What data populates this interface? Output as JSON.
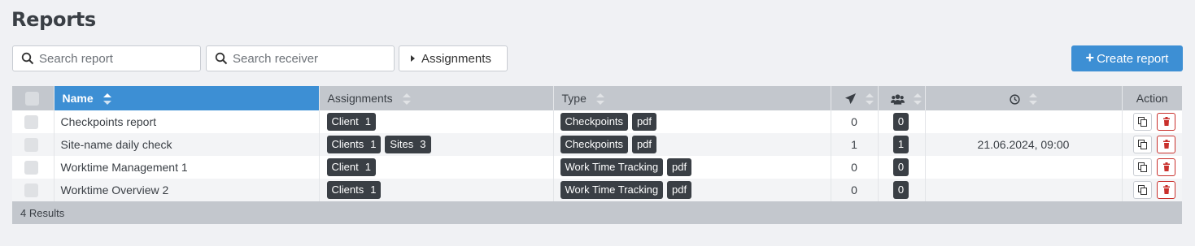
{
  "page": {
    "title": "Reports"
  },
  "toolbar": {
    "search_report_placeholder": "Search report",
    "search_receiver_placeholder": "Search receiver",
    "assignments_label": "Assignments",
    "create_label": "Create report"
  },
  "table": {
    "headers": {
      "name": "Name",
      "assignments": "Assignments",
      "type": "Type",
      "action": "Action"
    },
    "header_icons": {
      "sent": "paper-plane-icon",
      "receivers": "users-icon",
      "schedule": "clock-icon"
    },
    "rows": [
      {
        "name": "Checkpoints report",
        "assignments": [
          {
            "label": "Client",
            "count": "1"
          }
        ],
        "type": [
          "Checkpoints",
          "pdf"
        ],
        "sent": "0",
        "receivers": "0",
        "schedule": ""
      },
      {
        "name": "Site-name daily check",
        "assignments": [
          {
            "label": "Clients",
            "count": "1"
          },
          {
            "label": "Sites",
            "count": "3"
          }
        ],
        "type": [
          "Checkpoints",
          "pdf"
        ],
        "sent": "1",
        "receivers": "1",
        "schedule": "21.06.2024, 09:00"
      },
      {
        "name": "Worktime Management 1",
        "assignments": [
          {
            "label": "Client",
            "count": "1"
          }
        ],
        "type": [
          "Work Time Tracking",
          "pdf"
        ],
        "sent": "0",
        "receivers": "0",
        "schedule": ""
      },
      {
        "name": "Worktime Overview 2",
        "assignments": [
          {
            "label": "Clients",
            "count": "1"
          }
        ],
        "type": [
          "Work Time Tracking",
          "pdf"
        ],
        "sent": "0",
        "receivers": "0",
        "schedule": ""
      }
    ],
    "footer": "4 Results"
  },
  "colors": {
    "accent": "#3d8fd4",
    "header_bg": "#c3c7cd",
    "tag_bg": "#3a3f45",
    "danger": "#c9302c"
  }
}
